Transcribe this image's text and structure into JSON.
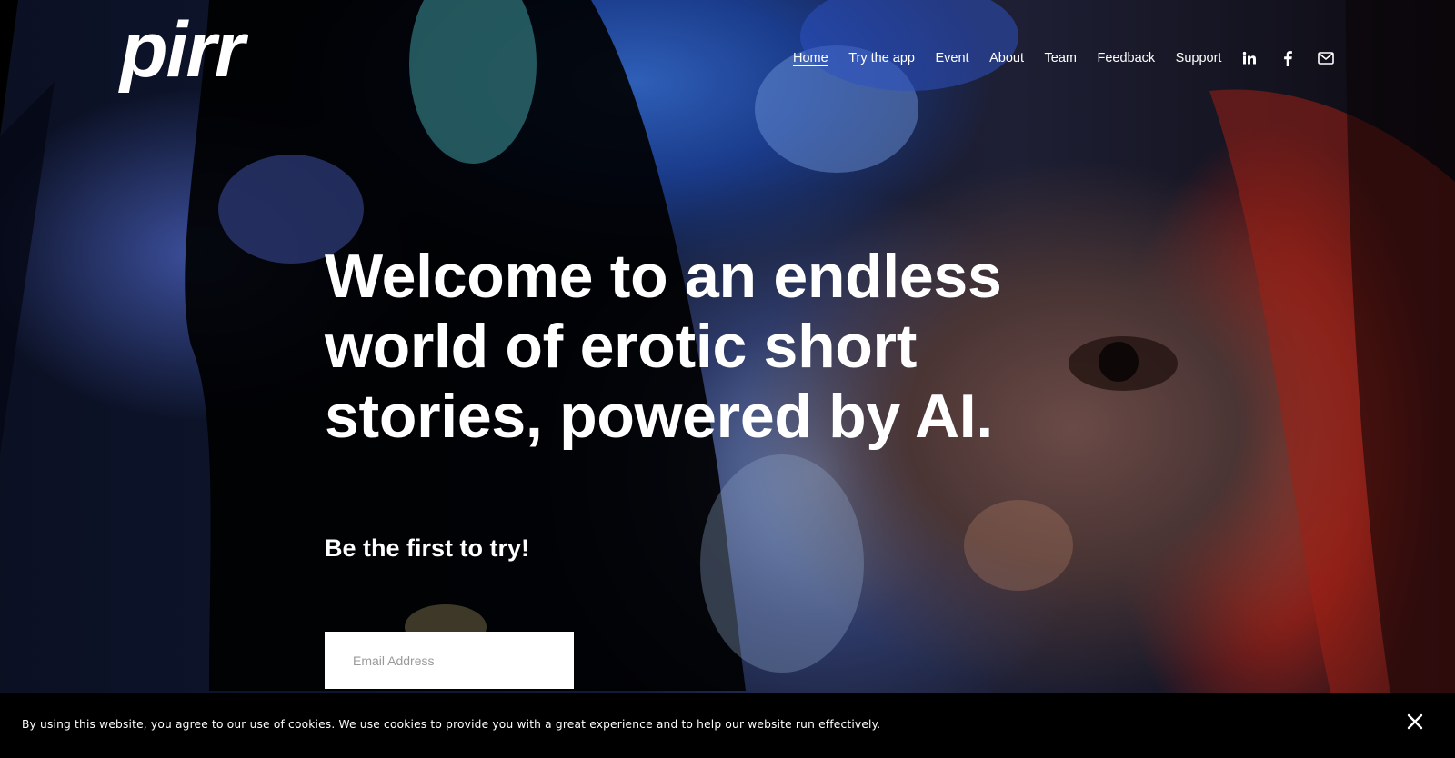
{
  "brand": {
    "logo_text": "pirr"
  },
  "nav": {
    "items": [
      {
        "label": "Home",
        "active": true
      },
      {
        "label": "Try the app",
        "active": false
      },
      {
        "label": "Event",
        "active": false
      },
      {
        "label": "About",
        "active": false
      },
      {
        "label": "Team",
        "active": false
      },
      {
        "label": "Feedback",
        "active": false
      },
      {
        "label": "Support",
        "active": false
      }
    ]
  },
  "social": {
    "icons": [
      "linkedin-icon",
      "facebook-icon",
      "email-icon"
    ]
  },
  "hero": {
    "headline": "Welcome to an endless world of erotic short stories, powered by AI.",
    "subheadline": "Be the first to try!",
    "email_placeholder": "Email Address"
  },
  "cookie_banner": {
    "text": "By using this website, you agree to our use of cookies. We use cookies to provide you with a great experience and to help our website run effectively.",
    "close_icon": "close-icon"
  },
  "colors": {
    "text": "#ffffff",
    "banner_bg": "#000000",
    "input_bg": "#ffffff"
  }
}
